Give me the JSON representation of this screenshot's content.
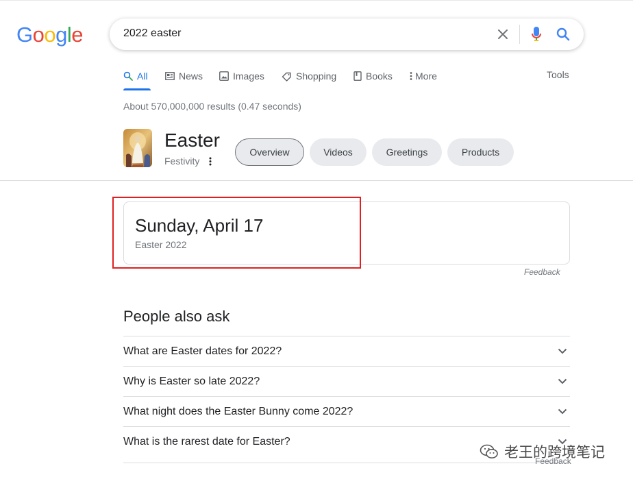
{
  "search": {
    "query": "2022 easter",
    "logo_letters": [
      {
        "char": "G",
        "color": "#4285F4"
      },
      {
        "char": "o",
        "color": "#EA4335"
      },
      {
        "char": "o",
        "color": "#FBBC05"
      },
      {
        "char": "g",
        "color": "#4285F4"
      },
      {
        "char": "l",
        "color": "#34A853"
      },
      {
        "char": "e",
        "color": "#EA4335"
      }
    ]
  },
  "tabs": [
    {
      "label": "All",
      "icon": "search-icon",
      "active": true
    },
    {
      "label": "News",
      "icon": "news-icon"
    },
    {
      "label": "Images",
      "icon": "image-icon"
    },
    {
      "label": "Shopping",
      "icon": "tag-icon"
    },
    {
      "label": "Books",
      "icon": "book-icon"
    },
    {
      "label": "More",
      "icon": "more-vert-icon"
    }
  ],
  "tools_label": "Tools",
  "result_stats": "About 570,000,000 results (0.47 seconds)",
  "knowledge_panel": {
    "title": "Easter",
    "subtitle": "Festivity",
    "chips": [
      "Overview",
      "Videos",
      "Greetings",
      "Products"
    ],
    "selected_chip": "Overview"
  },
  "answer": {
    "main": "Sunday, April 17",
    "sub": "Easter 2022",
    "feedback": "Feedback"
  },
  "people_also_ask": {
    "title": "People also ask",
    "questions": [
      "What are Easter dates for 2022?",
      "Why is Easter so late 2022?",
      "What night does the Easter Bunny come 2022?",
      "What is the rarest date for Easter?"
    ],
    "feedback": "Feedback"
  },
  "watermark": "老王的跨境笔记",
  "colors": {
    "accent": "#1a73e8",
    "highlight_box": "#e02020"
  }
}
